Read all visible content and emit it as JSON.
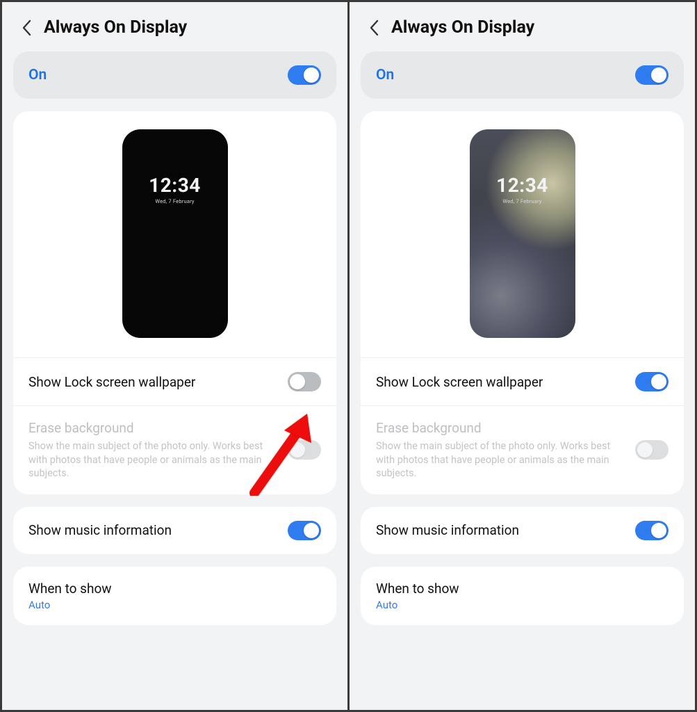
{
  "panes": [
    {
      "header": {
        "title": "Always On Display"
      },
      "on": {
        "label": "On",
        "enabled": true
      },
      "preview": {
        "time": "12:34",
        "date": "Wed, 7 February",
        "wallpaper": false
      },
      "showWallpaper": {
        "label": "Show Lock screen wallpaper",
        "enabled": false
      },
      "erase": {
        "label": "Erase background",
        "desc": "Show the main subject of the photo only. Works best with photos that have people or animals as the main subjects.",
        "enabled": false,
        "disabled": true
      },
      "music": {
        "label": "Show music information",
        "enabled": true
      },
      "when": {
        "label": "When to show",
        "value": "Auto"
      },
      "annotationArrow": true
    },
    {
      "header": {
        "title": "Always On Display"
      },
      "on": {
        "label": "On",
        "enabled": true
      },
      "preview": {
        "time": "12:34",
        "date": "Wed, 7 February",
        "wallpaper": true
      },
      "showWallpaper": {
        "label": "Show Lock screen wallpaper",
        "enabled": true
      },
      "erase": {
        "label": "Erase background",
        "desc": "Show the main subject of the photo only. Works best with photos that have people or animals as the main subjects.",
        "enabled": false,
        "disabled": true
      },
      "music": {
        "label": "Show music information",
        "enabled": true
      },
      "when": {
        "label": "When to show",
        "value": "Auto"
      },
      "annotationArrow": false
    }
  ]
}
